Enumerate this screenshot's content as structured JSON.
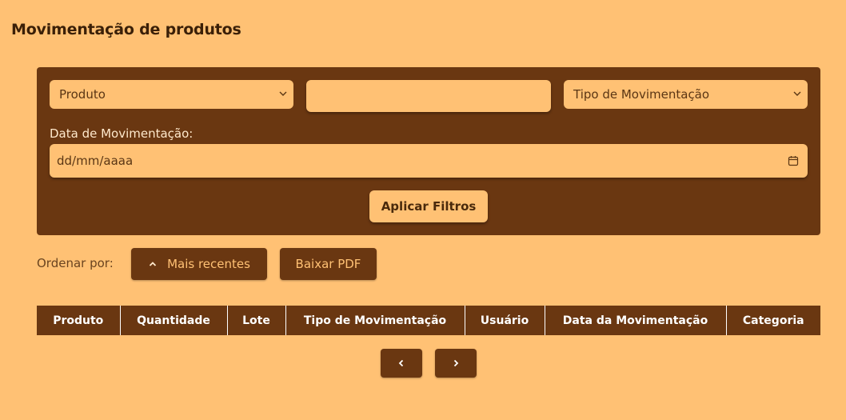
{
  "page": {
    "title": "Movimentação de produtos"
  },
  "filters": {
    "produto_select": {
      "value": "Produto",
      "icon": "chevron-down-icon"
    },
    "search_input": {
      "value": ""
    },
    "tipo_select": {
      "value": "Tipo de Movimentação",
      "icon": "chevron-down-icon"
    },
    "date_label": "Data de Movimentação:",
    "date_input": {
      "placeholder": "dd/mm/aaaa",
      "icon": "calendar-icon"
    },
    "apply_label": "Aplicar Filtros"
  },
  "toolbar": {
    "sort_label": "Ordenar por:",
    "sort_button_label": "Mais recentes",
    "sort_icon": "chevron-up-icon",
    "pdf_button_label": "Baixar PDF"
  },
  "table": {
    "headers": [
      "Produto",
      "Quantidade",
      "Lote",
      "Tipo de Movimentação",
      "Usuário",
      "Data da Movimentação",
      "Categoria"
    ],
    "rows": []
  },
  "pagination": {
    "prev_icon": "chevron-left-icon",
    "next_icon": "chevron-right-icon"
  },
  "colors": {
    "background": "#FFC174",
    "panel": "#6A3711",
    "text": "#4A2A0C"
  }
}
